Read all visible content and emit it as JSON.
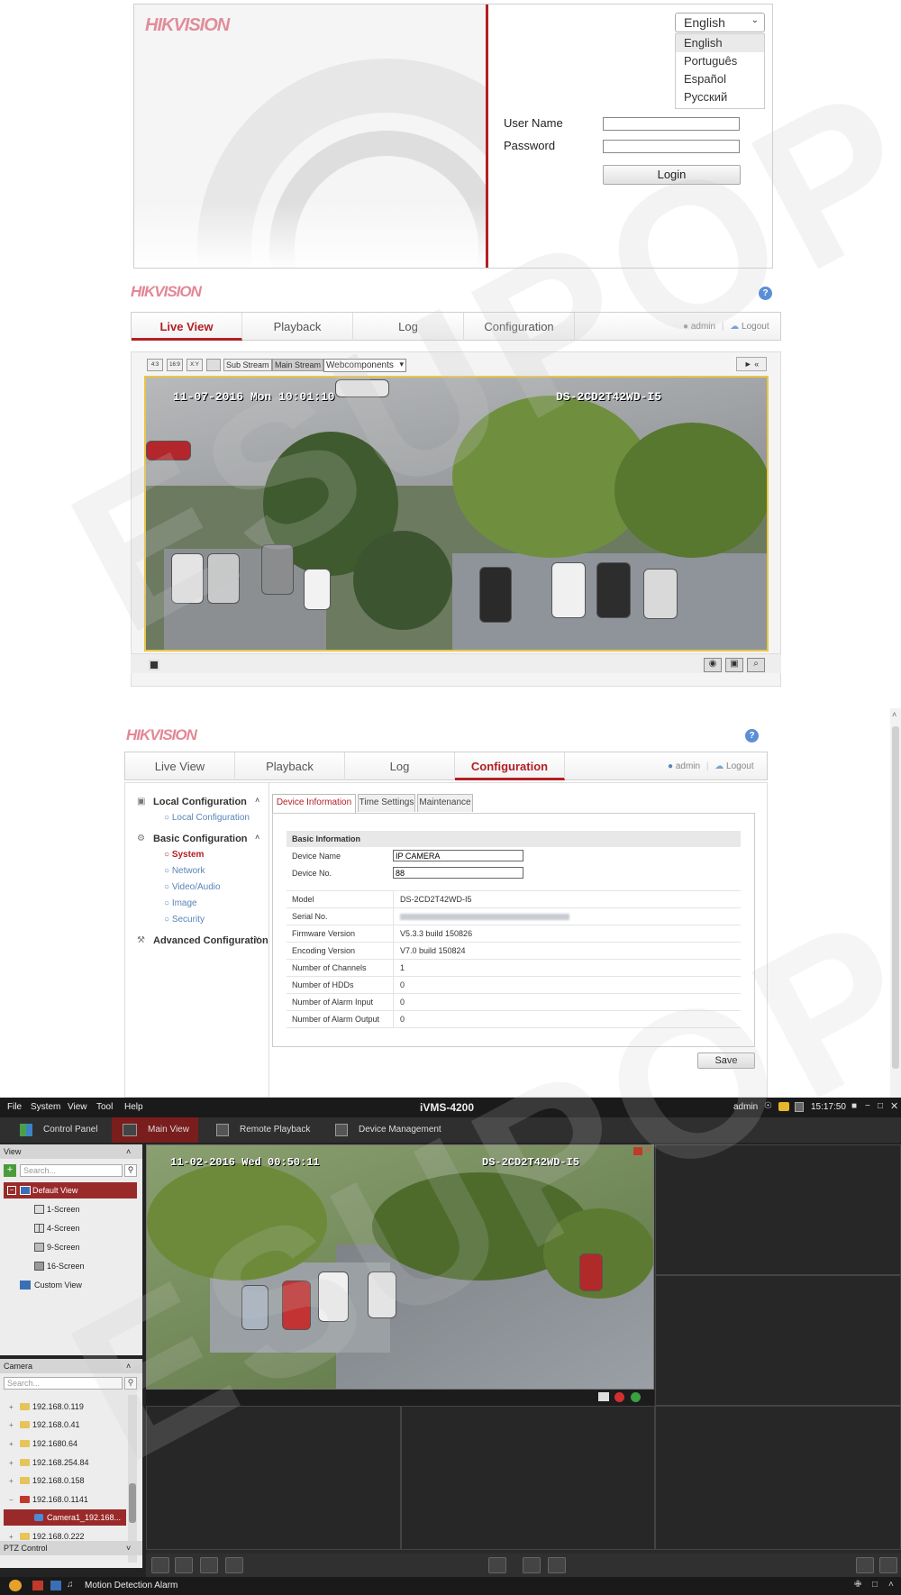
{
  "colors": {
    "brand_red": "#b21f24",
    "nav_blue": "#5a84b8",
    "ivms_dark": "#232323",
    "ivms_active_tab": "#7a1d1d"
  },
  "brand": {
    "logo_text": "HIKVISION"
  },
  "watermark": {
    "text": "ESUPOP"
  },
  "login": {
    "language_selected": "English",
    "language_options": [
      "English",
      "Português",
      "Español",
      "Русский"
    ],
    "username_label": "User Name",
    "password_label": "Password",
    "login_button": "Login"
  },
  "liveview": {
    "tabs": [
      "Live View",
      "Playback",
      "Log",
      "Configuration"
    ],
    "active_tab": "Live View",
    "user": "admin",
    "logout": "Logout",
    "help": "?",
    "stream_buttons": [
      "Sub Stream",
      "Main Stream"
    ],
    "plugin_select": "Webcomponents",
    "osd_datetime": "11-07-2016 Mon 10:01:10",
    "osd_model": "DS-2CD2T42WD-I5",
    "toolbar_icons": [
      "ratio-4-3-icon",
      "ratio-16-9-icon",
      "ratio-auto-icon",
      "fullscreen-icon"
    ],
    "bottom_icons": [
      "stop-icon",
      "snapshot-icon",
      "record-icon",
      "zoom-icon"
    ]
  },
  "config": {
    "tabs": [
      "Live View",
      "Playback",
      "Log",
      "Configuration"
    ],
    "active_tab": "Configuration",
    "user": "admin",
    "logout": "Logout",
    "help": "?",
    "sidebar": {
      "local_header": "Local Configuration",
      "local_items": [
        "Local Configuration"
      ],
      "basic_header": "Basic Configuration",
      "basic_items": [
        "System",
        "Network",
        "Video/Audio",
        "Image",
        "Security"
      ],
      "advanced_header": "Advanced Configuration"
    },
    "subtabs": [
      "Device Information",
      "Time Settings",
      "Maintenance"
    ],
    "section_title": "Basic Information",
    "device_name_label": "Device Name",
    "device_name_value": "IP CAMERA",
    "device_no_label": "Device No.",
    "device_no_value": "88",
    "info_rows": [
      {
        "k": "Model",
        "v": "DS-2CD2T42WD-I5"
      },
      {
        "k": "Serial No.",
        "v": ""
      },
      {
        "k": "Firmware Version",
        "v": "V5.3.3 build 150826"
      },
      {
        "k": "Encoding Version",
        "v": "V7.0 build 150824"
      },
      {
        "k": "Number of Channels",
        "v": "1"
      },
      {
        "k": "Number of HDDs",
        "v": "0"
      },
      {
        "k": "Number of Alarm Input",
        "v": "0"
      },
      {
        "k": "Number of Alarm Output",
        "v": "0"
      }
    ],
    "save_button": "Save"
  },
  "ivms": {
    "menu": [
      "File",
      "System",
      "View",
      "Tool",
      "Help"
    ],
    "title": "iVMS-4200",
    "user": "admin",
    "time": "15:17:50",
    "tabs": [
      "Control Panel",
      "Main View",
      "Remote Playback",
      "Device Management"
    ],
    "active_tab": "Main View",
    "view_header": "View",
    "view_search": "Search...",
    "view_items": [
      "Default View",
      "1-Screen",
      "4-Screen",
      "9-Screen",
      "16-Screen",
      "Custom View"
    ],
    "camera_header": "Camera",
    "camera_search": "Search...",
    "camera_items": [
      "192.168.0.119",
      "192.168.0.41",
      "192.1680.64",
      "192.168.254.84",
      "192.168.0.158",
      "192.168.0.1141",
      "Camera1_192.168...",
      "192.168.0.222"
    ],
    "ptz_header": "PTZ Control",
    "osd_datetime": "11-02-2016 Wed 00:50:11",
    "osd_model": "DS-2CD2T42WD-I5",
    "status_text": "Motion Detection Alarm"
  }
}
